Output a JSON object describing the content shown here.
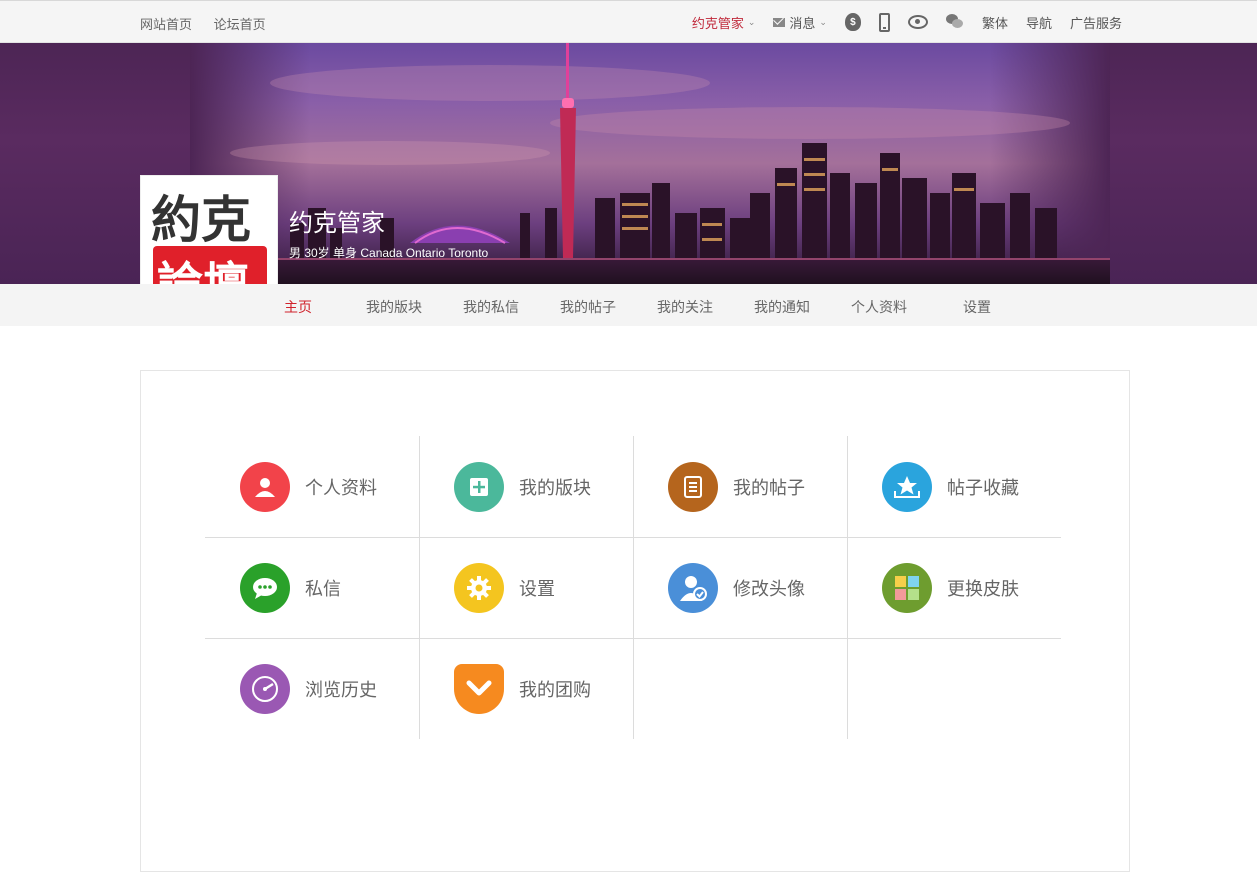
{
  "topbar": {
    "left_links": [
      "网站首页",
      "论坛首页"
    ],
    "user": "约克管家",
    "messages": "消息",
    "lang": "繁体",
    "nav": "导航",
    "ads": "广告服务"
  },
  "profile": {
    "name": "约克管家",
    "info": "男 30岁 单身 Canada Ontario Toronto",
    "avatar_line1": "約克",
    "avatar_line2": "論壇"
  },
  "nav": {
    "items": [
      "主页",
      "我的版块",
      "我的私信",
      "我的帖子",
      "我的关注",
      "我的通知",
      "个人资料",
      "设置"
    ],
    "active": "主页"
  },
  "grid": {
    "items": [
      {
        "label": "个人资料",
        "icon": "person-icon",
        "color": "#f2434a"
      },
      {
        "label": "我的版块",
        "icon": "plus-square-icon",
        "color": "#4bb89b"
      },
      {
        "label": "我的帖子",
        "icon": "document-icon",
        "color": "#b5651d"
      },
      {
        "label": "帖子收藏",
        "icon": "star-tray-icon",
        "color": "#2aa4dd"
      },
      {
        "label": "私信",
        "icon": "chat-bubble-icon",
        "color": "#2aa12a"
      },
      {
        "label": "设置",
        "icon": "gear-icon",
        "color": "#f4c51f"
      },
      {
        "label": "修改头像",
        "icon": "user-edit-icon",
        "color": "#4a8fd8"
      },
      {
        "label": "更换皮肤",
        "icon": "palette-grid-icon",
        "color": "#6e9d2f"
      },
      {
        "label": "浏览历史",
        "icon": "speedometer-icon",
        "color": "#9a58b3"
      },
      {
        "label": "我的团购",
        "icon": "pocket-icon",
        "color": "#f68a1f"
      }
    ]
  }
}
